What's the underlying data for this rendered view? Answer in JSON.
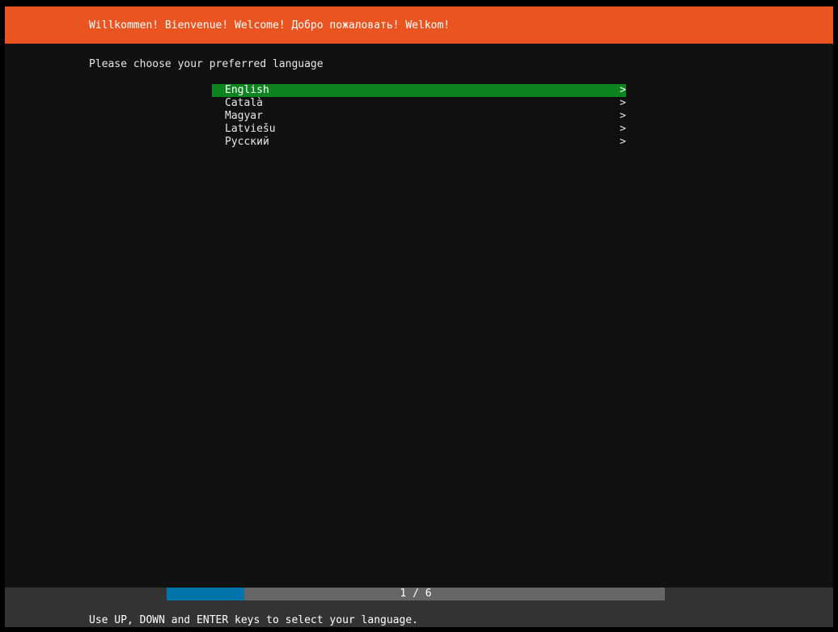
{
  "header": {
    "title": "Willkommen! Bienvenue! Welcome! Добро пожаловать! Welkom!"
  },
  "prompt": "Please choose your preferred language",
  "languages": [
    {
      "label": "English",
      "arrow": ">",
      "selected": true
    },
    {
      "label": "Català",
      "arrow": ">",
      "selected": false
    },
    {
      "label": "Magyar",
      "arrow": ">",
      "selected": false
    },
    {
      "label": "Latviešu",
      "arrow": ">",
      "selected": false
    },
    {
      "label": "Русский",
      "arrow": ">",
      "selected": false
    }
  ],
  "progress": {
    "text": "1 / 6",
    "fraction": 0.156
  },
  "help": "Use UP, DOWN and ENTER keys to select your language.",
  "colors": {
    "header_bg": "#e95420",
    "selected_bg": "#0e8420",
    "progress_fill": "#0073a8",
    "progress_track": "#666666",
    "footer_bg": "#333333",
    "screen_bg": "#111111"
  }
}
